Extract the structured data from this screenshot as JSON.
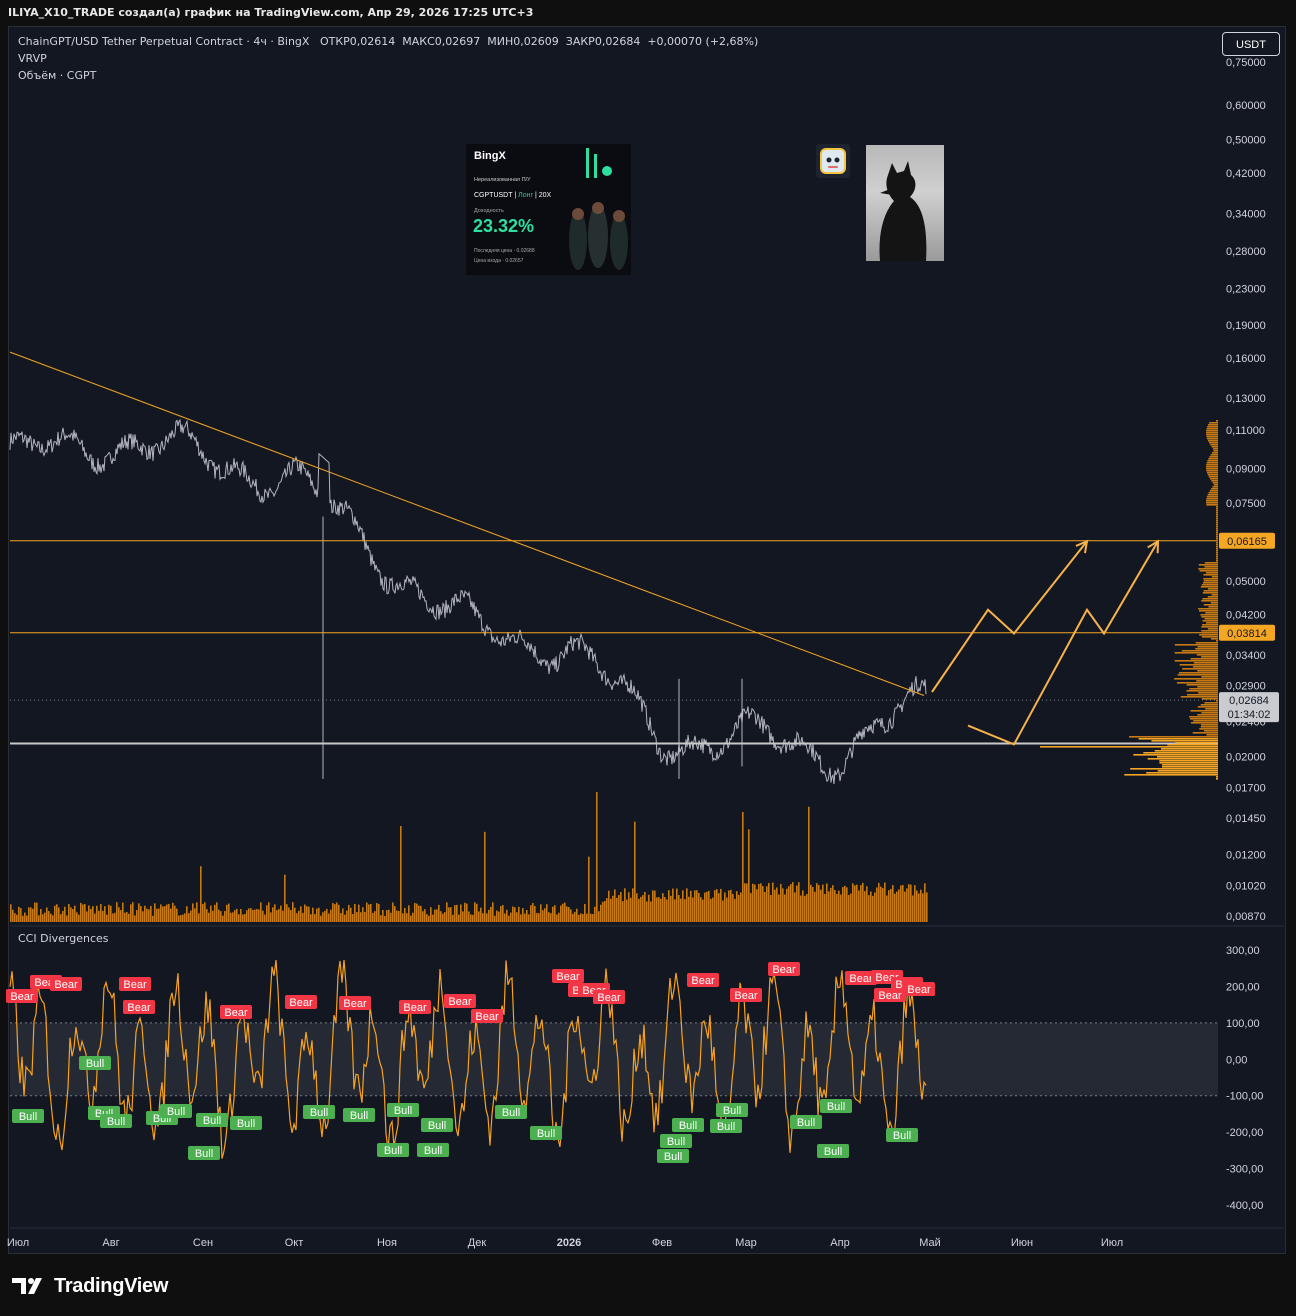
{
  "header": {
    "caption": "ILIYA_X10_TRADE создал(а) график на TradingView.com, Апр 29, 2026 17:25 UTC+3"
  },
  "legend": {
    "symbol": "ChainGPT/USD Tether Perpetual Contract · 4ч · BingX",
    "open_label": "ОТКР",
    "open": "0,02614",
    "high_label": "МАКС",
    "high": "0,02697",
    "low_label": "МИН",
    "low": "0,02609",
    "close_label": "ЗАКР",
    "close": "0,02684",
    "change": "+0,00070 (+2,68%)",
    "indicator1": "VRVP",
    "indicator2": "Объём · CGPT"
  },
  "currency_button": "USDT",
  "price_axis": {
    "ticks": [
      "0,75000",
      "0,60000",
      "0,50000",
      "0,42000",
      "0,34000",
      "0,28000",
      "0,23000",
      "0,19000",
      "0,16000",
      "0,13000",
      "0,11000",
      "0,09000",
      "0,07500",
      "0,05000",
      "0,04200",
      "0,03400",
      "0,02900",
      "0,02400",
      "0,02000",
      "0,01700",
      "0,01450",
      "0,01200",
      "0,01020",
      "0,00870"
    ],
    "tick_values": [
      0.75,
      0.6,
      0.5,
      0.42,
      0.34,
      0.28,
      0.23,
      0.19,
      0.16,
      0.13,
      0.11,
      0.09,
      0.075,
      0.05,
      0.042,
      0.034,
      0.029,
      0.024,
      0.02,
      0.017,
      0.0145,
      0.012,
      0.0102,
      0.0087
    ],
    "level_labels": [
      {
        "text": "0,06165",
        "value": 0.06165,
        "color": "#f5a623"
      },
      {
        "text": "0,03814",
        "value": 0.03814,
        "color": "#f5a623"
      }
    ],
    "current_price": "0,02684",
    "countdown": "01:34:02"
  },
  "cci_pane": {
    "title": "CCI Divergences",
    "ticks": [
      "300,00",
      "200,00",
      "100,00",
      "0,00",
      "-100,00",
      "-200,00",
      "-300,00",
      "-400,00"
    ],
    "tick_values": [
      300,
      200,
      100,
      0,
      -100,
      -200,
      -300,
      -400
    ],
    "bear_label": "Bear",
    "bull_label": "Bull"
  },
  "time_axis": {
    "labels": [
      "Июл",
      "Авг",
      "Сен",
      "Окт",
      "Ноя",
      "Дек",
      "2026",
      "Фев",
      "Мар",
      "Апр",
      "Май",
      "Июн",
      "Июл"
    ]
  },
  "overlay_card": {
    "brand": "BingX",
    "pnl_caption": "Нереализованная П/У",
    "pair": "CGPTUSDT",
    "side": "Лонг",
    "leverage": "20X",
    "yield_caption": "Доходность",
    "pnl_percent": "23.32%",
    "last_price": "Последняя цена · 0.02688",
    "entry_price": "Цена входа · 0.02657"
  },
  "footer": {
    "brand": "TradingView"
  },
  "colors": {
    "background": "#131722",
    "price_line": "#b2b5be",
    "accent": "#f5a623",
    "cci": "#f7a21b",
    "bear": "#f23645",
    "bull": "#4caf50",
    "volume": "#c77a14"
  },
  "chart_data": [
    {
      "type": "line",
      "title": "ChainGPT/USD Tether Perpetual Contract · 4ч · BingX",
      "y_scale": "log",
      "ylim": [
        0.0087,
        0.75
      ],
      "x": [
        "Июл",
        "Авг",
        "Сен",
        "Окт",
        "Ноя",
        "Дек",
        "2026",
        "Фев",
        "Мар",
        "Апр",
        "Май"
      ],
      "series": [
        {
          "values": [
            0.095,
            0.105,
            0.095,
            0.085,
            0.055,
            0.038,
            0.036,
            0.022,
            0.022,
            0.0205,
            0.0268
          ]
        }
      ],
      "horizontal_levels": [
        0.06165,
        0.03814,
        0.0214
      ],
      "trendline": {
        "from": [
          "Июл",
          0.165
        ],
        "to": [
          "Май",
          0.0275
        ]
      },
      "projection_paths": [
        [
          [
            "Май",
            0.028
          ],
          [
            "Май",
            0.043
          ],
          [
            "Май",
            0.038
          ],
          [
            "Июн",
            0.0615
          ]
        ],
        [
          [
            "Май",
            0.0235
          ],
          [
            "Май",
            0.0213
          ],
          [
            "Июн",
            0.043
          ],
          [
            "Июн",
            0.038
          ],
          [
            "Июл",
            0.0615
          ]
        ]
      ],
      "grid": false
    },
    {
      "type": "line",
      "title": "CCI Divergences",
      "ylim": [
        -400,
        300
      ],
      "band": [
        -100,
        100
      ],
      "signals": {
        "bear_count": 28,
        "bull_count": 29
      },
      "grid": false
    }
  ]
}
